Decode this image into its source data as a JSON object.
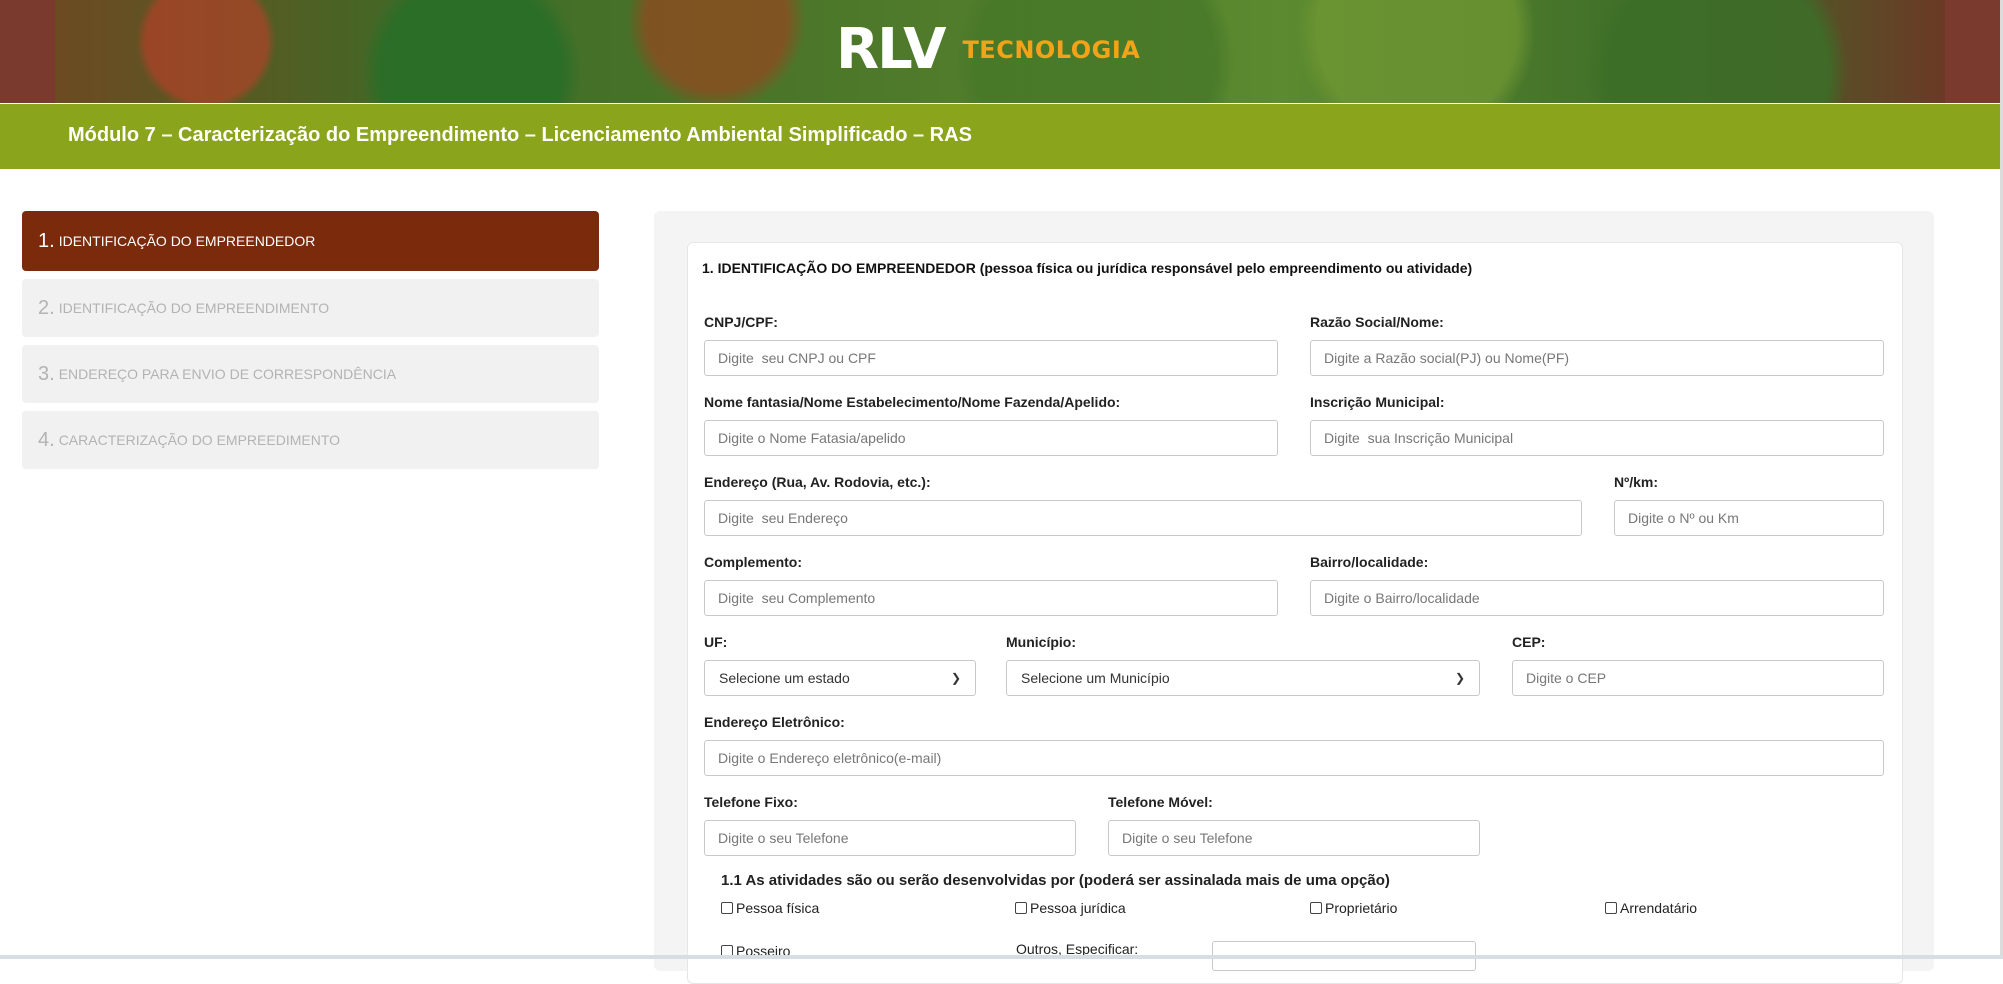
{
  "header": {
    "logo_main": "RLV",
    "logo_sub": "TECNOLOGIA"
  },
  "titlebar": {
    "title": "Módulo 7 – Caracterização do Empreendimento – Licenciamento Ambiental Simplificado – RAS"
  },
  "steps": [
    {
      "num": "1.",
      "label": "IDENTIFICAÇÃO DO EMPREENDEDOR"
    },
    {
      "num": "2.",
      "label": "IDENTIFICAÇÃO DO EMPREENDIMENTO"
    },
    {
      "num": "3.",
      "label": "ENDEREÇO PARA ENVIO DE CORRESPONDÊNCIA"
    },
    {
      "num": "4.",
      "label": "CARACTERIZAÇÃO DO EMPREEDIMENTO"
    }
  ],
  "form": {
    "section_title": "1. IDENTIFICAÇÃO DO EMPREENDEDOR (pessoa física ou jurídica responsável pelo empreendimento ou atividade)",
    "fields": {
      "cnpj": {
        "label": "CNPJ/CPF:",
        "placeholder": "Digite  seu CNPJ ou CPF"
      },
      "razao": {
        "label": "Razão Social/Nome:",
        "placeholder": "Digite a Razão social(PJ) ou Nome(PF)"
      },
      "fantasia": {
        "label": "Nome fantasia/Nome Estabelecimento/Nome Fazenda/Apelido:",
        "placeholder": "Digite o Nome Fatasia/apelido"
      },
      "inscricao": {
        "label": "Inscrição Municipal:",
        "placeholder": "Digite  sua Inscrição Municipal"
      },
      "endereco": {
        "label": "Endereço (Rua, Av. Rodovia, etc.):",
        "placeholder": "Digite  seu Endereço"
      },
      "numero": {
        "label": "Nº/km:",
        "placeholder": "Digite o Nº ou Km"
      },
      "complemento": {
        "label": "Complemento:",
        "placeholder": "Digite  seu Complemento"
      },
      "bairro": {
        "label": "Bairro/localidade:",
        "placeholder": "Digite o Bairro/localidade"
      },
      "uf": {
        "label": "UF:",
        "value": "Selecione um estado"
      },
      "municipio": {
        "label": "Município:",
        "value": "Selecione um Município"
      },
      "cep": {
        "label": "CEP:",
        "placeholder": "Digite o CEP"
      },
      "email": {
        "label": "Endereço Eletrônico:",
        "placeholder": "Digite o Endereço eletrônico(e-mail)"
      },
      "tel_fixo": {
        "label": "Telefone Fixo:",
        "placeholder": "Digite o seu Telefone"
      },
      "tel_movel": {
        "label": "Telefone Móvel:",
        "placeholder": "Digite o seu Telefone"
      }
    },
    "activities": {
      "question": "1.1 As atividades são ou serão desenvolvidas por (poderá ser assinalada mais de uma opção)",
      "options": [
        "Pessoa física",
        "Pessoa jurídica",
        "Proprietário",
        "Arrendatário",
        "Posseiro"
      ],
      "other_label": "Outros, Especificar:"
    }
  }
}
